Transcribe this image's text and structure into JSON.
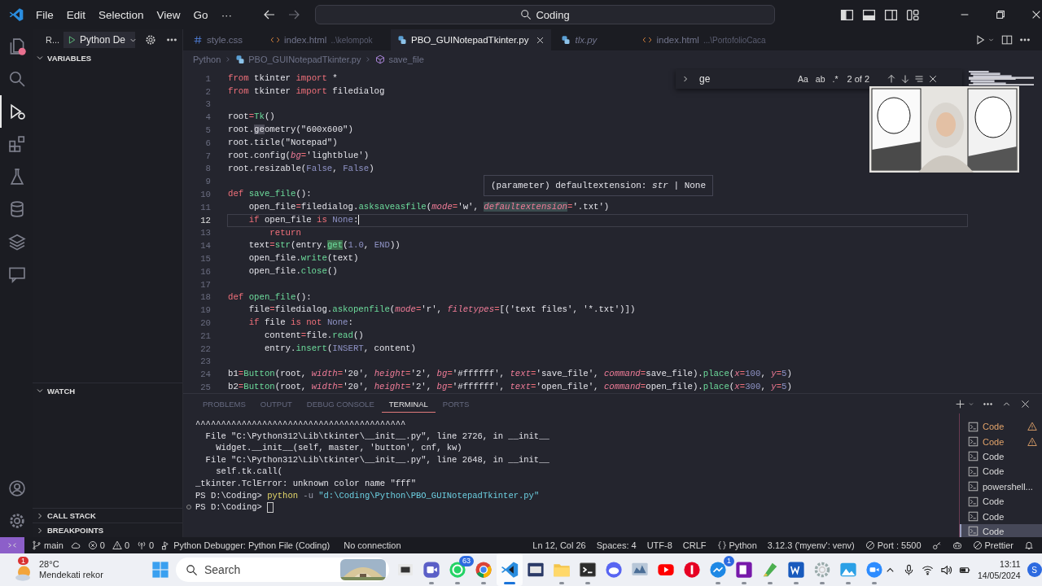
{
  "title_bar": {
    "menus": [
      "File",
      "Edit",
      "Selection",
      "View",
      "Go",
      "···"
    ],
    "back_enabled": true,
    "forward_enabled": false,
    "command_center": "Coding",
    "layout_toggles": [
      {
        "kind": "sidebar-left",
        "on": true
      },
      {
        "kind": "panel",
        "on": true
      },
      {
        "kind": "sidebar-right",
        "on": false
      },
      {
        "kind": "customize"
      }
    ]
  },
  "activity_bar": [
    {
      "kind": "files",
      "selected": false,
      "badge": true
    },
    {
      "kind": "search",
      "selected": false,
      "badge": false
    },
    {
      "kind": "debug",
      "selected": true,
      "badge": false
    },
    {
      "kind": "extensions",
      "selected": false,
      "badge": false
    },
    {
      "kind": "flask",
      "selected": false,
      "badge": false
    },
    {
      "kind": "database",
      "selected": false,
      "badge": false
    },
    {
      "kind": "layers",
      "selected": false,
      "badge": false
    },
    {
      "kind": "comment",
      "selected": false,
      "badge": false
    },
    {
      "kind": "account",
      "selected": false,
      "badge": false
    },
    {
      "kind": "settings",
      "selected": false,
      "badge": false
    }
  ],
  "sidebar": {
    "title": "R...",
    "launch_config": "Python De",
    "sections": [
      {
        "title": "VARIABLES",
        "expanded": true
      },
      {
        "title": "WATCH",
        "expanded": true
      },
      {
        "title": "CALL STACK",
        "expanded": false
      },
      {
        "title": "BREAKPOINTS",
        "expanded": false
      }
    ]
  },
  "editor_tabs": [
    {
      "kind": "css",
      "label": "style.css",
      "selected": false,
      "preview": false
    },
    {
      "kind": "html",
      "label": "index.html",
      "description": "..\\kelompok",
      "selected": false,
      "preview": false
    },
    {
      "kind": "python",
      "label": "PBO_GUINotepadTkinter.py",
      "selected": true,
      "preview": false
    },
    {
      "kind": "python",
      "label": "tlx.py",
      "selected": false,
      "preview": true
    },
    {
      "kind": "html",
      "label": "index.html",
      "description": "...\\PortofolioCaca",
      "selected": false,
      "preview": false
    }
  ],
  "breadcrumbs": [
    {
      "kind": "folder",
      "label": "Python"
    },
    {
      "kind": "python",
      "label": "PBO_GUINotepadTkinter.py"
    },
    {
      "kind": "method",
      "label": "save_file"
    }
  ],
  "find_widget": {
    "value": "ge",
    "options": [
      "Aa",
      "ab",
      ".*"
    ],
    "result": "2 of 2"
  },
  "hover_tooltip": "(parameter) defaultextension: *str* | None",
  "code_lines": [
    {
      "number": "1",
      "current": false,
      "tokens": [
        {
          "kind": "keyword",
          "text": "from"
        },
        {
          "kind": "plain",
          "text": " tkinter "
        },
        {
          "kind": "keyword",
          "text": "import"
        },
        {
          "kind": "plain",
          "text": " *"
        }
      ]
    },
    {
      "number": "2",
      "current": false,
      "tokens": [
        {
          "kind": "keyword",
          "text": "from"
        },
        {
          "kind": "plain",
          "text": " tkinter "
        },
        {
          "kind": "keyword",
          "text": "import"
        },
        {
          "kind": "plain",
          "text": " filedialog"
        }
      ]
    },
    {
      "number": "3",
      "current": false
    },
    {
      "number": "4",
      "current": false,
      "tokens": [
        {
          "kind": "plain",
          "text": "root"
        },
        {
          "kind": "operator",
          "text": "="
        },
        {
          "kind": "function",
          "text": "Tk"
        },
        {
          "kind": "plain",
          "text": "()"
        }
      ]
    },
    {
      "number": "5",
      "current": false,
      "tokens": [
        {
          "kind": "plain",
          "text": "root."
        },
        {
          "kind": "plain-match",
          "text": "ge"
        },
        {
          "kind": "plain",
          "text": "ometry(\"600x600\")"
        }
      ]
    },
    {
      "number": "6",
      "current": false,
      "tokens": [
        {
          "kind": "plain",
          "text": "root.title(\"Notepad\")"
        }
      ]
    },
    {
      "number": "7",
      "current": false,
      "tokens": [
        {
          "kind": "plain",
          "text": "root.config("
        },
        {
          "kind": "parameter",
          "text": "bg"
        },
        {
          "kind": "operator",
          "text": "="
        },
        {
          "kind": "plain",
          "text": "'lightblue')"
        }
      ]
    },
    {
      "number": "8",
      "current": false,
      "tokens": [
        {
          "kind": "plain",
          "text": "root.resizable("
        },
        {
          "kind": "constant",
          "text": "False"
        },
        {
          "kind": "plain",
          "text": ", "
        },
        {
          "kind": "constant",
          "text": "False"
        },
        {
          "kind": "plain",
          "text": ")"
        }
      ]
    },
    {
      "number": "9",
      "current": false
    },
    {
      "number": "10",
      "current": false,
      "tokens": [
        {
          "kind": "keyword",
          "text": "def "
        },
        {
          "kind": "function",
          "text": "save_file"
        },
        {
          "kind": "plain",
          "text": "():"
        }
      ]
    },
    {
      "number": "11",
      "current": false,
      "tokens": [
        {
          "kind": "plain",
          "text": "    open_file"
        },
        {
          "kind": "operator",
          "text": "="
        },
        {
          "kind": "plain",
          "text": "filedialog."
        },
        {
          "kind": "function",
          "text": "asksaveasfile"
        },
        {
          "kind": "plain",
          "text": "("
        },
        {
          "kind": "parameter",
          "text": "mode"
        },
        {
          "kind": "operator",
          "text": "="
        },
        {
          "kind": "plain",
          "text": "'w', "
        },
        {
          "kind": "parameter-selection",
          "text": "defaultextension"
        },
        {
          "kind": "operator",
          "text": "="
        },
        {
          "kind": "plain",
          "text": "'.txt')"
        }
      ]
    },
    {
      "number": "12",
      "current": true,
      "tokens": [
        {
          "kind": "keyword",
          "text": "    if"
        },
        {
          "kind": "plain",
          "text": " open_file "
        },
        {
          "kind": "keyword",
          "text": "is "
        },
        {
          "kind": "constant",
          "text": "None"
        },
        {
          "kind": "plain",
          "text": ":"
        }
      ]
    },
    {
      "number": "13",
      "current": false,
      "tokens": [
        {
          "kind": "keyword",
          "text": "        return"
        }
      ]
    },
    {
      "number": "14",
      "current": false,
      "tokens": [
        {
          "kind": "plain",
          "text": "    text"
        },
        {
          "kind": "operator",
          "text": "="
        },
        {
          "kind": "function",
          "text": "str"
        },
        {
          "kind": "plain",
          "text": "(entry."
        },
        {
          "kind": "function-current-match",
          "text": "get"
        },
        {
          "kind": "plain",
          "text": "("
        },
        {
          "kind": "constant",
          "text": "1.0"
        },
        {
          "kind": "plain",
          "text": ", "
        },
        {
          "kind": "constant",
          "text": "END"
        },
        {
          "kind": "plain",
          "text": "))"
        }
      ]
    },
    {
      "number": "15",
      "current": false,
      "tokens": [
        {
          "kind": "plain",
          "text": "    open_file."
        },
        {
          "kind": "function",
          "text": "write"
        },
        {
          "kind": "plain",
          "text": "(text)"
        }
      ]
    },
    {
      "number": "16",
      "current": false,
      "tokens": [
        {
          "kind": "plain",
          "text": "    open_file."
        },
        {
          "kind": "function",
          "text": "close"
        },
        {
          "kind": "plain",
          "text": "()"
        }
      ]
    },
    {
      "number": "17",
      "current": false
    },
    {
      "number": "18",
      "current": false,
      "tokens": [
        {
          "kind": "keyword",
          "text": "def "
        },
        {
          "kind": "function",
          "text": "open_file"
        },
        {
          "kind": "plain",
          "text": "():"
        }
      ]
    },
    {
      "number": "19",
      "current": false,
      "tokens": [
        {
          "kind": "plain",
          "text": "    file"
        },
        {
          "kind": "operator",
          "text": "="
        },
        {
          "kind": "plain",
          "text": "filedialog."
        },
        {
          "kind": "function",
          "text": "askopenfile"
        },
        {
          "kind": "plain",
          "text": "("
        },
        {
          "kind": "parameter",
          "text": "mode"
        },
        {
          "kind": "operator",
          "text": "="
        },
        {
          "kind": "plain",
          "text": "'r', "
        },
        {
          "kind": "parameter",
          "text": "filetypes"
        },
        {
          "kind": "operator",
          "text": "="
        },
        {
          "kind": "plain",
          "text": "[('text files', '*.txt')])"
        }
      ]
    },
    {
      "number": "20",
      "current": false,
      "tokens": [
        {
          "kind": "keyword",
          "text": "    if"
        },
        {
          "kind": "plain",
          "text": " file "
        },
        {
          "kind": "keyword",
          "text": "is not "
        },
        {
          "kind": "constant",
          "text": "None"
        },
        {
          "kind": "plain",
          "text": ":"
        }
      ]
    },
    {
      "number": "21",
      "current": false,
      "tokens": [
        {
          "kind": "plain",
          "text": "       content"
        },
        {
          "kind": "operator",
          "text": "="
        },
        {
          "kind": "plain",
          "text": "file."
        },
        {
          "kind": "function",
          "text": "read"
        },
        {
          "kind": "plain",
          "text": "()"
        }
      ]
    },
    {
      "number": "22",
      "current": false,
      "tokens": [
        {
          "kind": "plain",
          "text": "       entry."
        },
        {
          "kind": "function",
          "text": "insert"
        },
        {
          "kind": "plain",
          "text": "("
        },
        {
          "kind": "constant",
          "text": "INSERT"
        },
        {
          "kind": "plain",
          "text": ", content)"
        }
      ]
    },
    {
      "number": "23",
      "current": false
    },
    {
      "number": "24",
      "current": false,
      "tokens": [
        {
          "kind": "plain",
          "text": "b1"
        },
        {
          "kind": "operator",
          "text": "="
        },
        {
          "kind": "function",
          "text": "Button"
        },
        {
          "kind": "plain",
          "text": "(root, "
        },
        {
          "kind": "parameter",
          "text": "width"
        },
        {
          "kind": "operator",
          "text": "="
        },
        {
          "kind": "plain",
          "text": "'20', "
        },
        {
          "kind": "parameter",
          "text": "height"
        },
        {
          "kind": "operator",
          "text": "="
        },
        {
          "kind": "plain",
          "text": "'2', "
        },
        {
          "kind": "parameter",
          "text": "bg"
        },
        {
          "kind": "operator",
          "text": "="
        },
        {
          "kind": "plain",
          "text": "'#ffffff', "
        },
        {
          "kind": "parameter",
          "text": "text"
        },
        {
          "kind": "operator",
          "text": "="
        },
        {
          "kind": "plain",
          "text": "'save_file', "
        },
        {
          "kind": "parameter",
          "text": "command"
        },
        {
          "kind": "operator",
          "text": "="
        },
        {
          "kind": "plain",
          "text": "save_file)."
        },
        {
          "kind": "function",
          "text": "place"
        },
        {
          "kind": "plain",
          "text": "("
        },
        {
          "kind": "parameter",
          "text": "x"
        },
        {
          "kind": "operator",
          "text": "="
        },
        {
          "kind": "constant",
          "text": "100"
        },
        {
          "kind": "plain",
          "text": ", "
        },
        {
          "kind": "parameter",
          "text": "y"
        },
        {
          "kind": "operator",
          "text": "="
        },
        {
          "kind": "constant",
          "text": "5"
        },
        {
          "kind": "plain",
          "text": ")"
        }
      ]
    },
    {
      "number": "25",
      "current": false,
      "tokens": [
        {
          "kind": "plain",
          "text": "b2"
        },
        {
          "kind": "operator",
          "text": "="
        },
        {
          "kind": "function",
          "text": "Button"
        },
        {
          "kind": "plain",
          "text": "(root, "
        },
        {
          "kind": "parameter",
          "text": "width"
        },
        {
          "kind": "operator",
          "text": "="
        },
        {
          "kind": "plain",
          "text": "'20', "
        },
        {
          "kind": "parameter",
          "text": "height"
        },
        {
          "kind": "operator",
          "text": "="
        },
        {
          "kind": "plain",
          "text": "'2', "
        },
        {
          "kind": "parameter",
          "text": "bg"
        },
        {
          "kind": "operator",
          "text": "="
        },
        {
          "kind": "plain",
          "text": "'#ffffff', "
        },
        {
          "kind": "parameter",
          "text": "text"
        },
        {
          "kind": "operator",
          "text": "="
        },
        {
          "kind": "plain",
          "text": "'open_file', "
        },
        {
          "kind": "parameter",
          "text": "command"
        },
        {
          "kind": "operator",
          "text": "="
        },
        {
          "kind": "plain",
          "text": "open_file)."
        },
        {
          "kind": "function",
          "text": "place"
        },
        {
          "kind": "plain",
          "text": "("
        },
        {
          "kind": "parameter",
          "text": "x"
        },
        {
          "kind": "operator",
          "text": "="
        },
        {
          "kind": "constant",
          "text": "300"
        },
        {
          "kind": "plain",
          "text": ", "
        },
        {
          "kind": "parameter",
          "text": "y"
        },
        {
          "kind": "operator",
          "text": "="
        },
        {
          "kind": "constant",
          "text": "5"
        },
        {
          "kind": "plain",
          "text": ")"
        }
      ]
    }
  ],
  "panel": {
    "tabs": [
      {
        "label": "PROBLEMS",
        "selected": false
      },
      {
        "label": "OUTPUT",
        "selected": false
      },
      {
        "label": "DEBUG CONSOLE",
        "selected": false
      },
      {
        "label": "TERMINAL",
        "selected": true
      },
      {
        "label": "PORTS",
        "selected": false
      }
    ],
    "terminal_lines": [
      [
        {
          "kind": "plain",
          "text": "^^^^^^^^^^^^^^^^^^^^^^^^^^^^^^^^^^^^^^^^^"
        }
      ],
      [
        {
          "kind": "plain",
          "text": "  File \"C:\\Python312\\Lib\\tkinter\\__init__.py\", line 2726, in __init__"
        }
      ],
      [
        {
          "kind": "plain",
          "text": "    Widget.__init__(self, master, 'button', cnf, kw)"
        }
      ],
      [
        {
          "kind": "plain",
          "text": "  File \"C:\\Python312\\Lib\\tkinter\\__init__.py\", line 2648, in __init__"
        }
      ],
      [
        {
          "kind": "plain",
          "text": "    self.tk.call("
        }
      ],
      [
        {
          "kind": "plain",
          "text": "_tkinter.TclError: unknown color name \"fff\""
        }
      ],
      [
        {
          "kind": "plain",
          "text": "PS D:\\Coding> "
        },
        {
          "kind": "command",
          "text": "python"
        },
        {
          "kind": "flag",
          "text": " -u "
        },
        {
          "kind": "string",
          "text": "\"d:\\Coding\\Python\\PBO_GUINotepadTkinter.py\""
        }
      ],
      [
        {
          "kind": "prompt",
          "text": "PS D:\\Coding>"
        },
        {
          "kind": "cursor"
        }
      ]
    ],
    "terminals": [
      {
        "label": "Code",
        "warning": true,
        "selected": false
      },
      {
        "label": "Code",
        "warning": true,
        "selected": false
      },
      {
        "label": "Code",
        "warning": false,
        "selected": false
      },
      {
        "label": "Code",
        "warning": false,
        "selected": false
      },
      {
        "label": "powershell...",
        "warning": false,
        "selected": false
      },
      {
        "label": "Code",
        "warning": false,
        "selected": false
      },
      {
        "label": "Code",
        "warning": false,
        "selected": false
      },
      {
        "label": "Code",
        "warning": false,
        "selected": true
      }
    ]
  },
  "status_bar": {
    "left": [
      {
        "kind": "remote"
      },
      {
        "kind": "branch",
        "text": "main"
      },
      {
        "kind": "sync"
      },
      {
        "kind": "errors",
        "text": "0"
      },
      {
        "kind": "warnings",
        "text": "0"
      },
      {
        "kind": "ports",
        "text": "0"
      },
      {
        "kind": "debug",
        "text": "Python Debugger: Python File (Coding)"
      },
      {
        "kind": "plain",
        "text": "No connection"
      }
    ],
    "right": [
      {
        "kind": "plain",
        "text": "Ln 12, Col 26"
      },
      {
        "kind": "plain",
        "text": "Spaces: 4"
      },
      {
        "kind": "plain",
        "text": "UTF-8"
      },
      {
        "kind": "plain",
        "text": "CRLF"
      },
      {
        "kind": "braces",
        "text": "Python"
      },
      {
        "kind": "plain",
        "text": "3.12.3 ('myenv': venv)"
      },
      {
        "kind": "port",
        "text": "Port : 5500"
      },
      {
        "kind": "key"
      },
      {
        "kind": "copilot"
      },
      {
        "kind": "prettier",
        "text": "Prettier"
      },
      {
        "kind": "bell"
      }
    ]
  },
  "taskbar": {
    "weather": {
      "badge": "1",
      "temperature": "28°C",
      "caption": "Mendekati rekor"
    },
    "search_placeholder": "Search",
    "apps": [
      {
        "kind": "task-view",
        "running": false,
        "active": false
      },
      {
        "kind": "video-call",
        "running": true,
        "active": false
      },
      {
        "kind": "chat",
        "running": true,
        "active": false,
        "badge": "63"
      },
      {
        "kind": "browser",
        "running": true,
        "active": false
      },
      {
        "kind": "code-editor",
        "running": true,
        "active": true
      },
      {
        "kind": "dev",
        "running": false,
        "active": false
      },
      {
        "kind": "folder",
        "running": true,
        "active": false
      },
      {
        "kind": "terminal",
        "running": true,
        "active": false
      },
      {
        "kind": "game-chat",
        "running": false,
        "active": false
      },
      {
        "kind": "monitor",
        "running": false,
        "active": false
      },
      {
        "kind": "video-player",
        "running": false,
        "active": false
      },
      {
        "kind": "pin",
        "running": false,
        "active": false
      },
      {
        "kind": "chat-bubble",
        "running": true,
        "active": false,
        "badge": "1"
      },
      {
        "kind": "notebook",
        "running": true,
        "active": false
      },
      {
        "kind": "paint",
        "running": true,
        "active": false
      },
      {
        "kind": "document",
        "running": true,
        "active": false
      },
      {
        "kind": "settings",
        "running": true,
        "active": false
      },
      {
        "kind": "photos",
        "running": true,
        "active": false
      },
      {
        "kind": "meeting",
        "running": true,
        "active": false
      }
    ],
    "time": "13:11",
    "date": "14/05/2024",
    "notification": "S"
  }
}
